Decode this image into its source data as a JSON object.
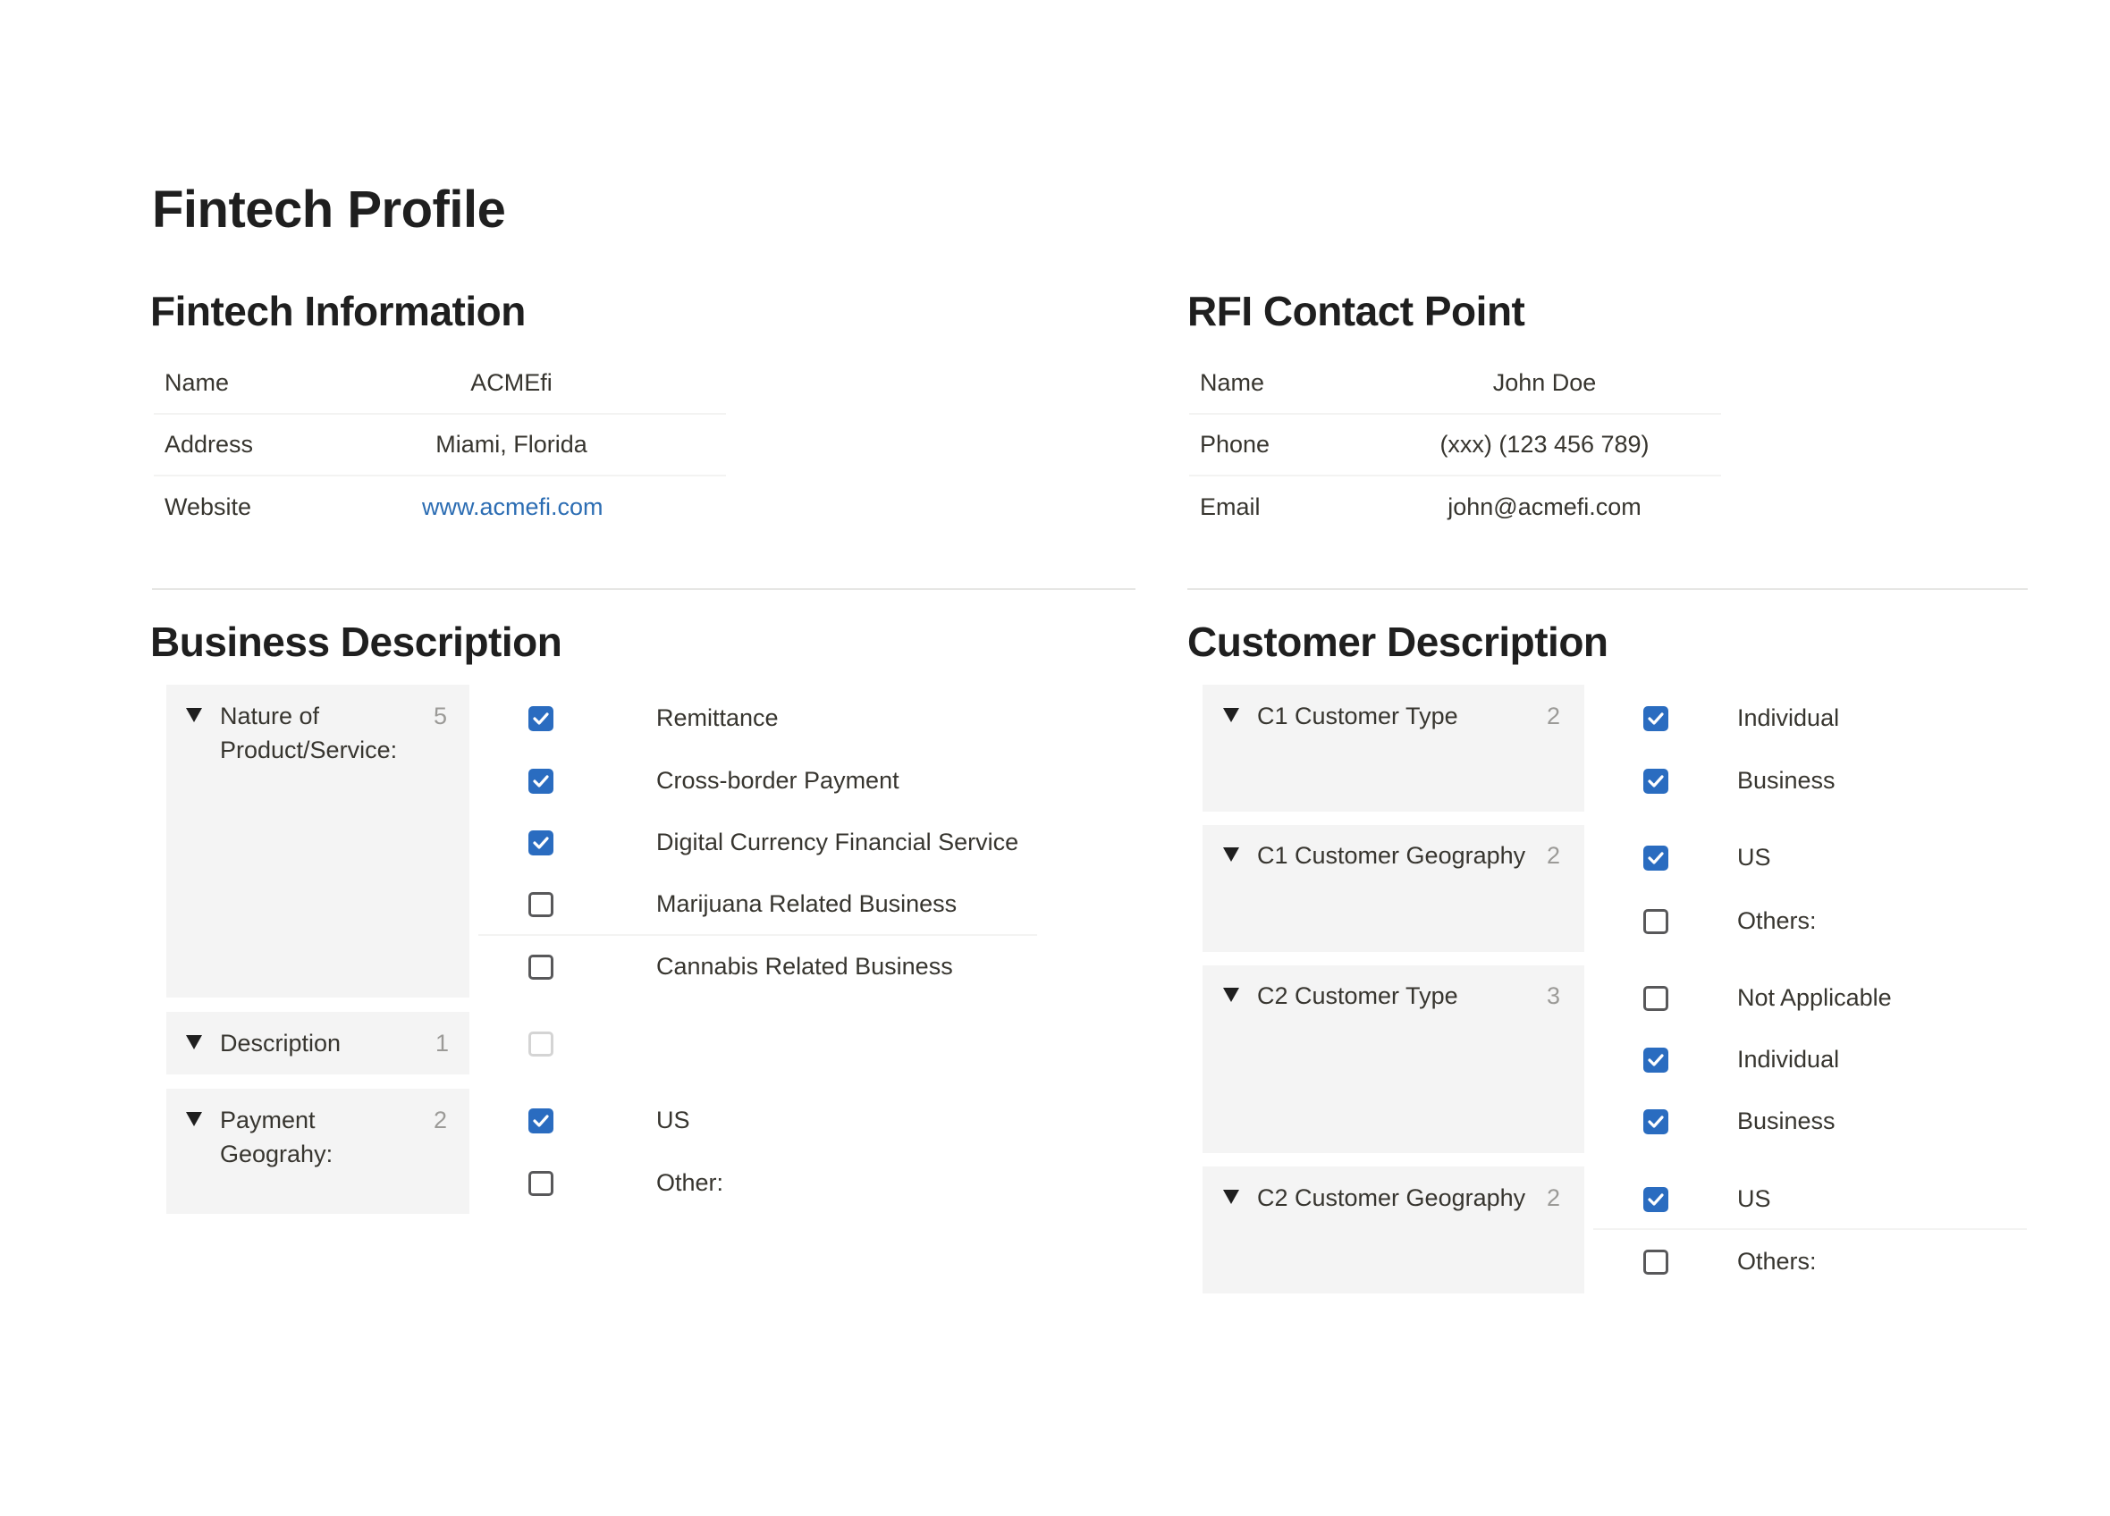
{
  "page": {
    "title": "Fintech Profile"
  },
  "fintech_info": {
    "title": "Fintech Information",
    "rows": [
      {
        "key": "Name",
        "value": "ACMEfi"
      },
      {
        "key": "Address",
        "value": "Miami, Florida"
      },
      {
        "key": "Website",
        "value": "www.acmefi.com"
      }
    ]
  },
  "rfi_contact": {
    "title": "RFI Contact Point",
    "rows": [
      {
        "key": "Name",
        "value": "John Doe"
      },
      {
        "key": "Phone",
        "value": "(xxx) (123 456 789)"
      },
      {
        "key": "Email",
        "value": "john@acmefi.com"
      }
    ]
  },
  "business": {
    "title": "Business Description",
    "groups": [
      {
        "label_lines": [
          "Nature of",
          "Product/Service:"
        ],
        "count": "5",
        "options": [
          {
            "label": "Remittance",
            "checked": true
          },
          {
            "label": "Cross-border Payment",
            "checked": true
          },
          {
            "label": "Digital Currency Financial Service",
            "checked": true
          },
          {
            "label": "Marijuana Related Business",
            "checked": false
          },
          {
            "label": "Cannabis Related Business",
            "checked": false
          }
        ]
      },
      {
        "label_lines": [
          "Description"
        ],
        "count": "1",
        "options": [
          {
            "label": "",
            "checked": false
          }
        ]
      },
      {
        "label_lines": [
          "Payment",
          "Geograhy:"
        ],
        "count": "2",
        "options": [
          {
            "label": "US",
            "checked": true
          },
          {
            "label": "Other:",
            "checked": false
          }
        ]
      }
    ]
  },
  "customer": {
    "title": "Customer Description",
    "groups": [
      {
        "label": "C1 Customer Type",
        "count": "2",
        "options": [
          {
            "label": "Individual",
            "checked": true
          },
          {
            "label": "Business",
            "checked": true
          }
        ]
      },
      {
        "label": "C1 Customer Geography",
        "count": "2",
        "options": [
          {
            "label": "US",
            "checked": true
          },
          {
            "label": "Others:",
            "checked": false
          }
        ]
      },
      {
        "label": "C2 Customer Type",
        "count": "3",
        "options": [
          {
            "label": "Not Applicable",
            "checked": false
          },
          {
            "label": "Individual",
            "checked": true
          },
          {
            "label": "Business",
            "checked": true
          }
        ]
      },
      {
        "label": "C2 Customer Geography",
        "count": "2",
        "options": [
          {
            "label": "US",
            "checked": true
          },
          {
            "label": "Others:",
            "checked": false
          }
        ]
      }
    ]
  },
  "colors": {
    "accent": "#2a6cc0",
    "link": "#2c6db3",
    "group_bg": "#f4f4f4"
  }
}
